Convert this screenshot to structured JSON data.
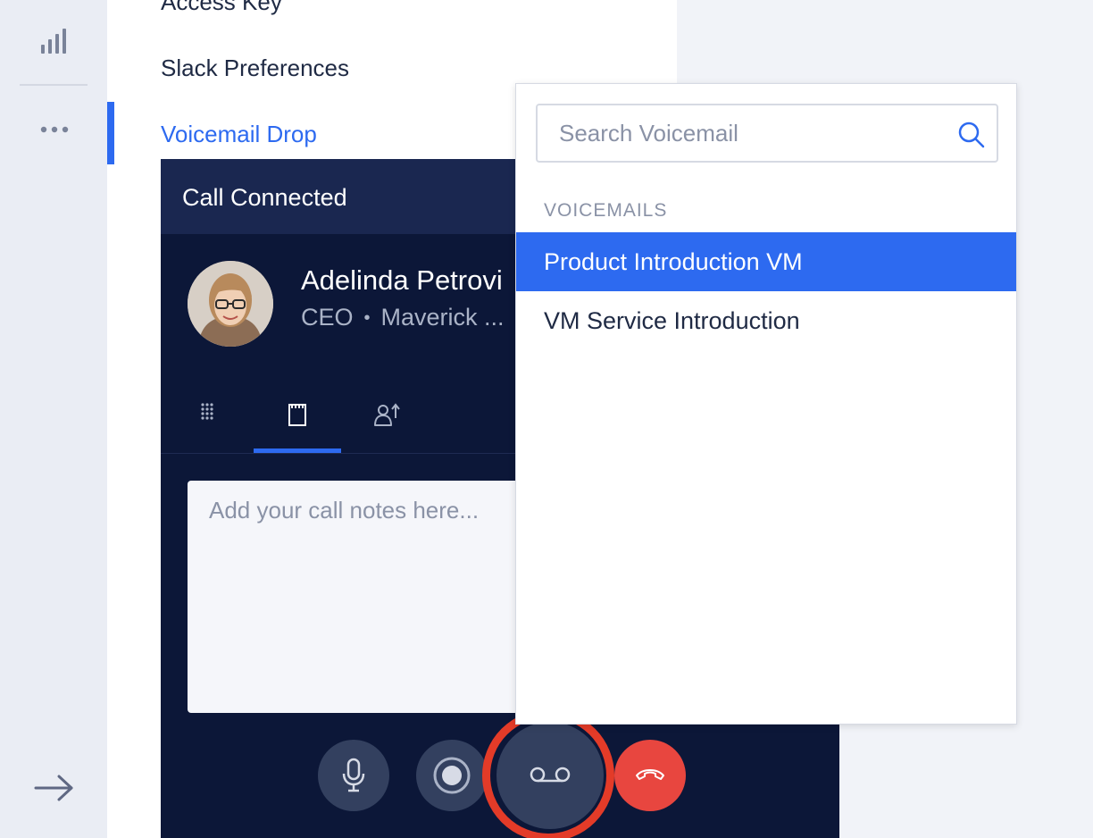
{
  "settings": {
    "items": [
      {
        "label": "Access Key"
      },
      {
        "label": "Slack Preferences"
      },
      {
        "label": "Voicemail Drop"
      }
    ]
  },
  "call": {
    "title": "Call Connected",
    "contact": {
      "name": "Adelinda Petrovi",
      "role": "CEO",
      "separator": "•",
      "company": "Maverick ..."
    },
    "tabs": [
      {
        "icon": "dialpad-icon"
      },
      {
        "icon": "notes-icon"
      },
      {
        "icon": "transfer-icon"
      }
    ],
    "notes_placeholder": "Add your call notes here...",
    "controls": [
      {
        "icon": "microphone-icon"
      },
      {
        "icon": "record-icon"
      },
      {
        "icon": "voicemail-icon"
      },
      {
        "icon": "hang-up-icon"
      }
    ]
  },
  "voicemail_dropdown": {
    "search_placeholder": "Search Voicemail",
    "section_label": "VOICEMAILS",
    "items": [
      {
        "label": "Product Introduction VM",
        "selected": true
      },
      {
        "label": "VM Service Introduction",
        "selected": false
      }
    ]
  },
  "colors": {
    "accent": "#2d6af0",
    "call_bg": "#0c1738",
    "hang_up": "#e8463f",
    "highlight_ring": "#e33b28"
  }
}
